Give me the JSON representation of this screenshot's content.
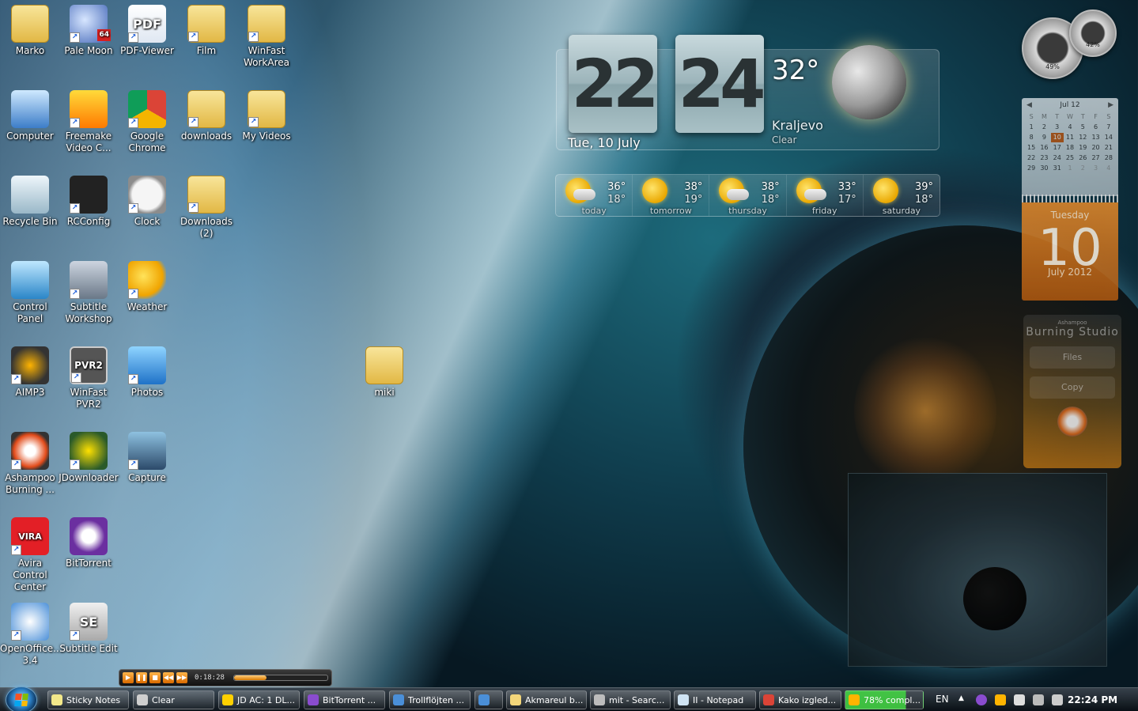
{
  "desktop_icons": {
    "marko": "Marko",
    "pale_moon": "Pale Moon",
    "pale_moon_badge": "64",
    "pdf_viewer": "PDF-Viewer",
    "pdf_glyph": "PDF",
    "film": "Film",
    "winfast_workarea": "WinFast WorkArea",
    "computer": "Computer",
    "freemake": "Freemake Video C...",
    "chrome": "Google Chrome",
    "downloads": "downloads",
    "my_videos": "My Videos",
    "recycle_bin": "Recycle Bin",
    "rcconfig": "RCConfig",
    "clock": "Clock",
    "downloads2": "Downloads (2)",
    "control_panel": "Control Panel",
    "subtitle_workshop": "Subtitle Workshop",
    "weather": "Weather",
    "aimp3": "AIMP3",
    "winfast_pvr2": "WinFast PVR2",
    "pvr2_glyph": "PVR2",
    "photos": "Photos",
    "miki": "miki",
    "ashampoo": "Ashampoo Burning ...",
    "jdownloader": "JDownloader",
    "capture": "Capture",
    "avira": "Avira Control Center",
    "avira_glyph": "VIRA",
    "bittorrent": "BitTorrent",
    "openoffice": "OpenOffice... 3.4",
    "subtitle_edit": "Subtitle Edit",
    "se_glyph": "SE"
  },
  "clock_gadget": {
    "hours": "22",
    "minutes": "24",
    "date": "Tue, 10 July",
    "temperature": "32°",
    "city": "Kraljevo",
    "condition": "Clear"
  },
  "forecast": [
    {
      "name": "today",
      "hi": "36°",
      "lo": "18°",
      "cloudy": true
    },
    {
      "name": "tomorrow",
      "hi": "38°",
      "lo": "19°",
      "cloudy": false
    },
    {
      "name": "thursday",
      "hi": "38°",
      "lo": "18°",
      "cloudy": true
    },
    {
      "name": "friday",
      "hi": "33°",
      "lo": "17°",
      "cloudy": true
    },
    {
      "name": "saturday",
      "hi": "39°",
      "lo": "18°",
      "cloudy": false
    }
  ],
  "meters": {
    "cpu_pct": "49%",
    "ram_pct": "42%"
  },
  "calendar": {
    "month_label": "Jul 12",
    "day_headers": [
      "S",
      "M",
      "T",
      "W",
      "T",
      "F",
      "S"
    ],
    "weeks": [
      [
        "1",
        "2",
        "3",
        "4",
        "5",
        "6",
        "7"
      ],
      [
        "8",
        "9",
        "10",
        "11",
        "12",
        "13",
        "14"
      ],
      [
        "15",
        "16",
        "17",
        "18",
        "19",
        "20",
        "21"
      ],
      [
        "22",
        "23",
        "24",
        "25",
        "26",
        "27",
        "28"
      ],
      [
        "29",
        "30",
        "31",
        "1",
        "2",
        "3",
        "4"
      ]
    ],
    "today": "10",
    "day_name": "Tuesday",
    "day_number": "10",
    "month_year": "July 2012"
  },
  "burning_gadget": {
    "brand": "Ashampoo",
    "title": "Burning Studio",
    "button_files": "Files",
    "button_copy": "Copy"
  },
  "mini_player": {
    "time": "0:18:28",
    "progress": 0.35
  },
  "taskbar": {
    "tasks": [
      {
        "label": "Sticky Notes",
        "color": "#f3e88a"
      },
      {
        "label": "Clear",
        "color": "#cfcfcf"
      },
      {
        "label": "JD AC: 1 DL...",
        "color": "#ffd000"
      },
      {
        "label": "BitTorrent ...",
        "color": "#8a4ccf"
      },
      {
        "label": "Trollflöjten ...",
        "color": "#4a8fd8"
      },
      {
        "label": "",
        "color": "#4a8fd8"
      },
      {
        "label": "Akmareul b...",
        "color": "#f3d67a"
      },
      {
        "label": "mit - Searc...",
        "color": "#bcbcbc"
      },
      {
        "label": "II - Notepad",
        "color": "#cfe3f3"
      },
      {
        "label": "Kako izgled...",
        "color": "#db4437"
      },
      {
        "label": "78% compl...",
        "color": "#ffb400"
      }
    ],
    "language": "EN",
    "clock": "22:24 PM"
  }
}
